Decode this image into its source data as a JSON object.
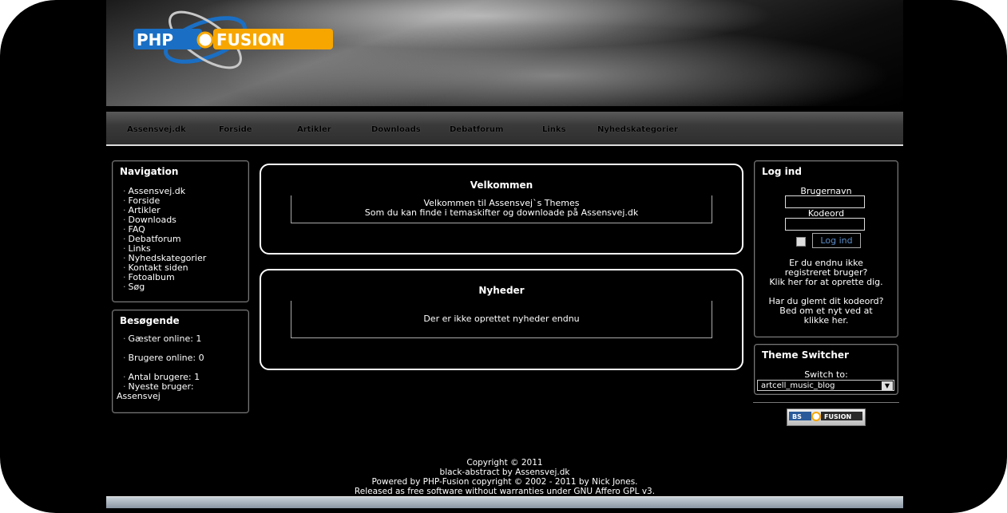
{
  "logo": {
    "text_left": "PHP",
    "text_right": "FUSION"
  },
  "nav": [
    "Assensvej.dk",
    "Forside",
    "Artikler",
    "Downloads",
    "Debatforum",
    "Links",
    "Nyhedskategorier"
  ],
  "navigation_panel": {
    "title": "Navigation",
    "items": [
      "Assensvej.dk",
      "Forside",
      "Artikler",
      "Downloads",
      "FAQ",
      "Debatforum",
      "Links",
      "Nyhedskategorier",
      "Kontakt siden",
      "Fotoalbum",
      "Søg"
    ]
  },
  "visitors_panel": {
    "title": "Besøgende",
    "guests": "Gæster online: 1",
    "members": "Brugere online: 0",
    "total": "Antal brugere: 1",
    "newest_label": "Nyeste bruger:",
    "newest_user": "Assensvej"
  },
  "welcome": {
    "title": "Velkommen",
    "line1": "Velkommen til Assensvej`s Themes",
    "line2": "Som du kan finde i temaskifter og downloade på Assensvej.dk"
  },
  "news": {
    "title": "Nyheder",
    "empty": "Der er ikke oprettet nyheder endnu"
  },
  "login": {
    "title": "Log ind",
    "username_label": "Brugernavn",
    "password_label": "Kodeord",
    "button": "Log ind",
    "register_1": "Er du endnu ikke",
    "register_2": "registreret bruger?",
    "register_3": "Klik her for at oprette dig.",
    "forgot_1": "Har du glemt dit kodeord?",
    "forgot_2": "Bed om et nyt ved at",
    "forgot_3": "klikke her."
  },
  "theme_switcher": {
    "title": "Theme Switcher",
    "label": "Switch to:",
    "selected": "artcell_music_blog"
  },
  "badge": {
    "left": "BS",
    "right": "FUSION"
  },
  "footer": {
    "line1": "Copyright © 2011",
    "line2": "black-abstract by Assensvej.dk",
    "line3": "Powered by PHP-Fusion copyright © 2002 - 2011 by Nick Jones.",
    "line4": "Released as free software without warranties under GNU Affero GPL v3."
  },
  "colors": {
    "link_blue": "#5a8cc8",
    "logo_blue": "#1a6fc4",
    "logo_orange": "#f7a600"
  }
}
